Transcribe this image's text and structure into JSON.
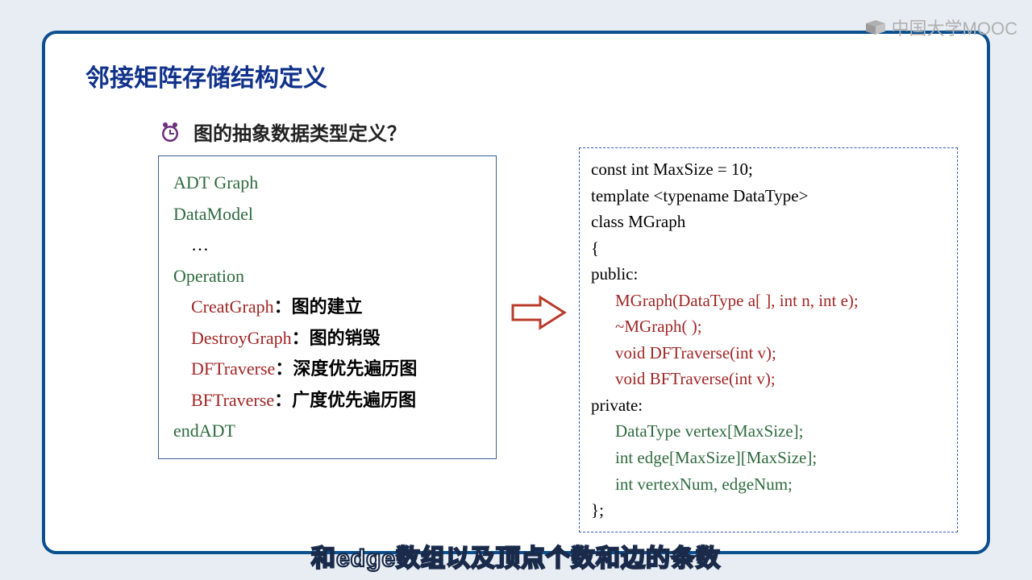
{
  "watermark": "中国大学MOOC",
  "title": "邻接矩阵存储结构定义",
  "subtitle": "图的抽象数据类型定义？",
  "left": {
    "l1": "ADT  Graph",
    "l2": "DataModel",
    "l3": "…",
    "l4": "Operation",
    "op1": "CreatGraph",
    "d1": "图的建立",
    "op2": "DestroyGraph",
    "d2": "图的销毁",
    "op3": "DFTraverse",
    "d3": "深度优先遍历图",
    "op4": "BFTraverse",
    "d4": "广度优先遍历图",
    "l9": "endADT",
    "colon": "："
  },
  "right": {
    "l1": "const int MaxSize = 10;",
    "l2": "template <typename DataType>",
    "l3": "class MGraph",
    "l4": "{",
    "l5": "public:",
    "p1": "MGraph(DataType a[ ], int n, int e);",
    "p2": "~MGraph( );",
    "p3": "void DFTraverse(int v);",
    "p4": "void BFTraverse(int v);",
    "l6": "private:",
    "q1": "DataType vertex[MaxSize];",
    "q2": "int edge[MaxSize][MaxSize];",
    "q3": "int vertexNum, edgeNum;",
    "l7": "};"
  },
  "caption": "和edge数组以及顶点个数和边的条数"
}
